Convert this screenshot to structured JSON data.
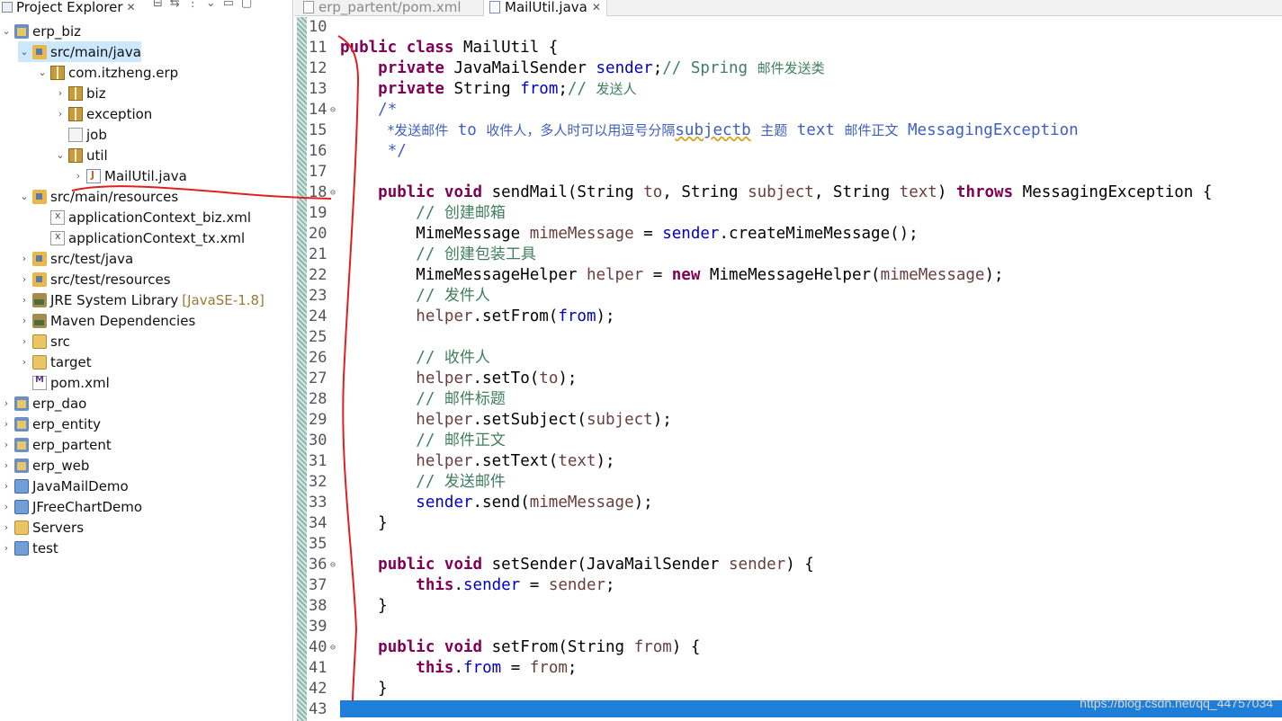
{
  "explorer": {
    "title": "Project Explorer",
    "close_glyph": "✕",
    "items": [
      {
        "label": "erp_biz",
        "icon": "maven-project-icon",
        "chevron": "⌄",
        "decor": ""
      },
      {
        "label": "src/main/java",
        "icon": "source-folder-icon",
        "chevron": "⌄",
        "decor": ""
      },
      {
        "label": "com.itzheng.erp",
        "icon": "package-icon",
        "chevron": "⌄",
        "decor": ""
      },
      {
        "label": "biz",
        "icon": "package-icon",
        "chevron": "›",
        "decor": ""
      },
      {
        "label": "exception",
        "icon": "package-icon",
        "chevron": "›",
        "decor": ""
      },
      {
        "label": "job",
        "icon": "empty-package-icon",
        "chevron": "",
        "decor": ""
      },
      {
        "label": "util",
        "icon": "package-icon",
        "chevron": "⌄",
        "decor": ""
      },
      {
        "label": "MailUtil.java",
        "icon": "java-file-icon",
        "chevron": "›",
        "decor": ""
      },
      {
        "label": "src/main/resources",
        "icon": "source-folder-icon",
        "chevron": "⌄",
        "decor": ""
      },
      {
        "label": "applicationContext_biz.xml",
        "icon": "xml-file-icon",
        "chevron": "",
        "decor": ""
      },
      {
        "label": "applicationContext_tx.xml",
        "icon": "xml-file-icon",
        "chevron": "",
        "decor": ""
      },
      {
        "label": "src/test/java",
        "icon": "source-folder-icon",
        "chevron": "›",
        "decor": ""
      },
      {
        "label": "src/test/resources",
        "icon": "source-folder-icon",
        "chevron": "›",
        "decor": ""
      },
      {
        "label": "JRE System Library",
        "icon": "library-icon",
        "chevron": "›",
        "decor": "[JavaSE-1.8]"
      },
      {
        "label": "Maven Dependencies",
        "icon": "library-icon",
        "chevron": "›",
        "decor": ""
      },
      {
        "label": "src",
        "icon": "folder-icon",
        "chevron": "›",
        "decor": ""
      },
      {
        "label": "target",
        "icon": "folder-icon",
        "chevron": "›",
        "decor": ""
      },
      {
        "label": "pom.xml",
        "icon": "pom-file-icon",
        "chevron": "",
        "decor": ""
      },
      {
        "label": "erp_dao",
        "icon": "maven-project-icon",
        "chevron": "›",
        "decor": ""
      },
      {
        "label": "erp_entity",
        "icon": "maven-project-icon",
        "chevron": "›",
        "decor": ""
      },
      {
        "label": "erp_partent",
        "icon": "maven-project-icon",
        "chevron": "›",
        "decor": ""
      },
      {
        "label": "erp_web",
        "icon": "maven-project-icon",
        "chevron": "›",
        "decor": ""
      },
      {
        "label": "JavaMailDemo",
        "icon": "project-icon",
        "chevron": "›",
        "decor": ""
      },
      {
        "label": "JFreeChartDemo",
        "icon": "project-icon",
        "chevron": "›",
        "decor": ""
      },
      {
        "label": "Servers",
        "icon": "folder-icon",
        "chevron": "›",
        "decor": ""
      },
      {
        "label": "test",
        "icon": "project-icon",
        "chevron": "›",
        "decor": ""
      }
    ]
  },
  "editor": {
    "tabs": [
      {
        "label": "erp_partent/pom.xml",
        "active": false
      },
      {
        "label": "MailUtil.java",
        "active": true,
        "close_glyph": "✕"
      }
    ],
    "lines": [
      {
        "n": "10",
        "fold": false,
        "tokens": []
      },
      {
        "n": "11",
        "fold": false,
        "tokens": [
          {
            "t": "kw",
            "v": "public class "
          },
          {
            "t": "",
            "v": "MailUtil {"
          }
        ]
      },
      {
        "n": "12",
        "fold": false,
        "tokens": [
          {
            "t": "",
            "v": "    "
          },
          {
            "t": "kw",
            "v": "private "
          },
          {
            "t": "",
            "v": "JavaMailSender "
          },
          {
            "t": "fld",
            "v": "sender"
          },
          {
            "t": "",
            "v": ";"
          },
          {
            "t": "cm",
            "v": "// Spring "
          },
          {
            "t": "cmcn",
            "v": "邮件发送类"
          }
        ]
      },
      {
        "n": "13",
        "fold": false,
        "tokens": [
          {
            "t": "",
            "v": "    "
          },
          {
            "t": "kw",
            "v": "private "
          },
          {
            "t": "",
            "v": "String "
          },
          {
            "t": "fld",
            "v": "from"
          },
          {
            "t": "",
            "v": ";"
          },
          {
            "t": "cm",
            "v": "// "
          },
          {
            "t": "cmcn",
            "v": "发送人"
          }
        ]
      },
      {
        "n": "14",
        "fold": true,
        "tokens": [
          {
            "t": "",
            "v": "    "
          },
          {
            "t": "jd",
            "v": "/*"
          }
        ]
      },
      {
        "n": "15",
        "fold": false,
        "tokens": [
          {
            "t": "",
            "v": "     "
          },
          {
            "t": "jdcn",
            "v": "*发送邮件"
          },
          {
            "t": "jd",
            "v": " to "
          },
          {
            "t": "jdcn",
            "v": "收件人，多人时可以用逗号分隔"
          },
          {
            "t": "jdsq",
            "v": "subjectb"
          },
          {
            "t": "jd",
            "v": " "
          },
          {
            "t": "jdcn",
            "v": "主题"
          },
          {
            "t": "jd",
            "v": " text "
          },
          {
            "t": "jdcn",
            "v": "邮件正文"
          },
          {
            "t": "jd",
            "v": " MessagingException"
          }
        ]
      },
      {
        "n": "16",
        "fold": false,
        "tokens": [
          {
            "t": "",
            "v": "     "
          },
          {
            "t": "jd",
            "v": "*/"
          }
        ]
      },
      {
        "n": "17",
        "fold": false,
        "tokens": []
      },
      {
        "n": "18",
        "fold": true,
        "tokens": [
          {
            "t": "",
            "v": "    "
          },
          {
            "t": "kw",
            "v": "public void "
          },
          {
            "t": "",
            "v": "sendMail(String "
          },
          {
            "t": "par",
            "v": "to"
          },
          {
            "t": "",
            "v": ", String "
          },
          {
            "t": "par",
            "v": "subject"
          },
          {
            "t": "",
            "v": ", String "
          },
          {
            "t": "par",
            "v": "text"
          },
          {
            "t": "",
            "v": ") "
          },
          {
            "t": "kw",
            "v": "throws "
          },
          {
            "t": "",
            "v": "MessagingException {"
          }
        ]
      },
      {
        "n": "19",
        "fold": false,
        "tokens": [
          {
            "t": "",
            "v": "        "
          },
          {
            "t": "cm",
            "v": "// "
          },
          {
            "t": "cmcnb",
            "v": "创建邮箱"
          }
        ]
      },
      {
        "n": "20",
        "fold": false,
        "tokens": [
          {
            "t": "",
            "v": "        MimeMessage "
          },
          {
            "t": "par",
            "v": "mimeMessage"
          },
          {
            "t": "",
            "v": " = "
          },
          {
            "t": "fld",
            "v": "sender"
          },
          {
            "t": "",
            "v": ".createMimeMessage();"
          }
        ]
      },
      {
        "n": "21",
        "fold": false,
        "tokens": [
          {
            "t": "",
            "v": "        "
          },
          {
            "t": "cm",
            "v": "// "
          },
          {
            "t": "cmcnb",
            "v": "创建包装工具"
          }
        ]
      },
      {
        "n": "22",
        "fold": false,
        "tokens": [
          {
            "t": "",
            "v": "        MimeMessageHelper "
          },
          {
            "t": "par",
            "v": "helper"
          },
          {
            "t": "",
            "v": " = "
          },
          {
            "t": "kw",
            "v": "new "
          },
          {
            "t": "",
            "v": "MimeMessageHelper("
          },
          {
            "t": "par",
            "v": "mimeMessage"
          },
          {
            "t": "",
            "v": ");"
          }
        ]
      },
      {
        "n": "23",
        "fold": false,
        "tokens": [
          {
            "t": "",
            "v": "        "
          },
          {
            "t": "cm",
            "v": "// "
          },
          {
            "t": "cmcnb",
            "v": "发件人"
          }
        ]
      },
      {
        "n": "24",
        "fold": false,
        "tokens": [
          {
            "t": "",
            "v": "        "
          },
          {
            "t": "par",
            "v": "helper"
          },
          {
            "t": "",
            "v": ".setFrom("
          },
          {
            "t": "fld",
            "v": "from"
          },
          {
            "t": "",
            "v": ");"
          }
        ]
      },
      {
        "n": "25",
        "fold": false,
        "tokens": []
      },
      {
        "n": "26",
        "fold": false,
        "tokens": [
          {
            "t": "",
            "v": "        "
          },
          {
            "t": "cm",
            "v": "// "
          },
          {
            "t": "cmcnb",
            "v": "收件人"
          }
        ]
      },
      {
        "n": "27",
        "fold": false,
        "tokens": [
          {
            "t": "",
            "v": "        "
          },
          {
            "t": "par",
            "v": "helper"
          },
          {
            "t": "",
            "v": ".setTo("
          },
          {
            "t": "par",
            "v": "to"
          },
          {
            "t": "",
            "v": ");"
          }
        ]
      },
      {
        "n": "28",
        "fold": false,
        "tokens": [
          {
            "t": "",
            "v": "        "
          },
          {
            "t": "cm",
            "v": "// "
          },
          {
            "t": "cmcnb",
            "v": "邮件标题"
          }
        ]
      },
      {
        "n": "29",
        "fold": false,
        "tokens": [
          {
            "t": "",
            "v": "        "
          },
          {
            "t": "par",
            "v": "helper"
          },
          {
            "t": "",
            "v": ".setSubject("
          },
          {
            "t": "par",
            "v": "subject"
          },
          {
            "t": "",
            "v": ");"
          }
        ]
      },
      {
        "n": "30",
        "fold": false,
        "tokens": [
          {
            "t": "",
            "v": "        "
          },
          {
            "t": "cm",
            "v": "// "
          },
          {
            "t": "cmcnb",
            "v": "邮件正文"
          }
        ]
      },
      {
        "n": "31",
        "fold": false,
        "tokens": [
          {
            "t": "",
            "v": "        "
          },
          {
            "t": "par",
            "v": "helper"
          },
          {
            "t": "",
            "v": ".setText("
          },
          {
            "t": "par",
            "v": "text"
          },
          {
            "t": "",
            "v": ");"
          }
        ]
      },
      {
        "n": "32",
        "fold": false,
        "tokens": [
          {
            "t": "",
            "v": "        "
          },
          {
            "t": "cm",
            "v": "// "
          },
          {
            "t": "cmcnb",
            "v": "发送邮件"
          }
        ]
      },
      {
        "n": "33",
        "fold": false,
        "tokens": [
          {
            "t": "",
            "v": "        "
          },
          {
            "t": "fld",
            "v": "sender"
          },
          {
            "t": "",
            "v": ".send("
          },
          {
            "t": "par",
            "v": "mimeMessage"
          },
          {
            "t": "",
            "v": ");"
          }
        ]
      },
      {
        "n": "34",
        "fold": false,
        "tokens": [
          {
            "t": "",
            "v": "    }"
          }
        ]
      },
      {
        "n": "35",
        "fold": false,
        "tokens": []
      },
      {
        "n": "36",
        "fold": true,
        "tokens": [
          {
            "t": "",
            "v": "    "
          },
          {
            "t": "kw",
            "v": "public void "
          },
          {
            "t": "",
            "v": "setSender(JavaMailSender "
          },
          {
            "t": "par",
            "v": "sender"
          },
          {
            "t": "",
            "v": ") {"
          }
        ]
      },
      {
        "n": "37",
        "fold": false,
        "tokens": [
          {
            "t": "",
            "v": "        "
          },
          {
            "t": "kw",
            "v": "this"
          },
          {
            "t": "",
            "v": "."
          },
          {
            "t": "fld",
            "v": "sender"
          },
          {
            "t": "",
            "v": " = "
          },
          {
            "t": "par",
            "v": "sender"
          },
          {
            "t": "",
            "v": ";"
          }
        ]
      },
      {
        "n": "38",
        "fold": false,
        "tokens": [
          {
            "t": "",
            "v": "    }"
          }
        ]
      },
      {
        "n": "39",
        "fold": false,
        "tokens": []
      },
      {
        "n": "40",
        "fold": true,
        "tokens": [
          {
            "t": "",
            "v": "    "
          },
          {
            "t": "kw",
            "v": "public void "
          },
          {
            "t": "",
            "v": "setFrom(String "
          },
          {
            "t": "par",
            "v": "from"
          },
          {
            "t": "",
            "v": ") {"
          }
        ]
      },
      {
        "n": "41",
        "fold": false,
        "tokens": [
          {
            "t": "",
            "v": "        "
          },
          {
            "t": "kw",
            "v": "this"
          },
          {
            "t": "",
            "v": "."
          },
          {
            "t": "fld",
            "v": "from"
          },
          {
            "t": "",
            "v": " = "
          },
          {
            "t": "par",
            "v": "from"
          },
          {
            "t": "",
            "v": ";"
          }
        ]
      },
      {
        "n": "42",
        "fold": false,
        "tokens": [
          {
            "t": "",
            "v": "    }"
          }
        ]
      },
      {
        "n": "43",
        "fold": false,
        "tokens": []
      }
    ],
    "fold_glyph": "⊖"
  },
  "watermark": "https://blog.csdn.net/qq_44757034",
  "colors": {
    "keyword": "#7f0055",
    "field": "#0000c0",
    "comment": "#3f7f5f",
    "javadoc": "#3f5fbf",
    "param": "#6a3e3e",
    "annotation_pen": "#e02020",
    "status_bar": "#1f7fd8"
  }
}
